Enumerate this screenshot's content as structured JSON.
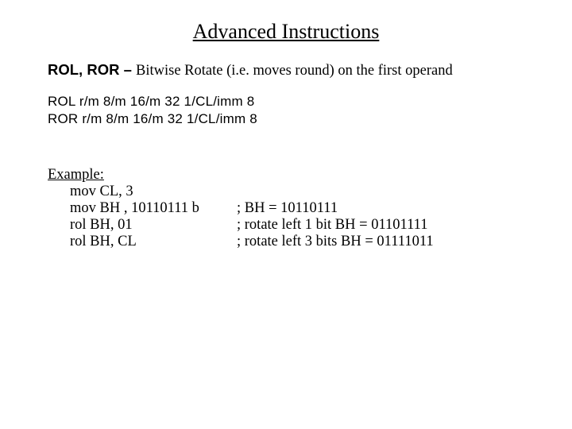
{
  "title": "Advanced Instructions",
  "intro": {
    "mnemonics": "ROL, ROR",
    "dash": " – ",
    "desc": "Bitwise Rotate (i.e. moves round) on the first operand"
  },
  "syntax": {
    "line1_mn": "ROL",
    "line1_ops": "  r/m 8/m 16/m 32     1/CL/imm 8",
    "line2_mn": "ROR",
    "line2_ops": "  r/m 8/m 16/m 32    1/CL/imm 8"
  },
  "example": {
    "label": "Example:",
    "r1_code": "mov  CL, 3",
    "r2_code": "mov BH , 10110111 b",
    "r2_comment": ";  BH = 10110111",
    "r3_code": "rol BH, 01",
    "r3_comment": ";   rotate left 1 bit BH = 01101111",
    "r4_code": "rol BH, CL",
    "r4_comment": "; rotate left 3 bits BH = 01111011"
  }
}
